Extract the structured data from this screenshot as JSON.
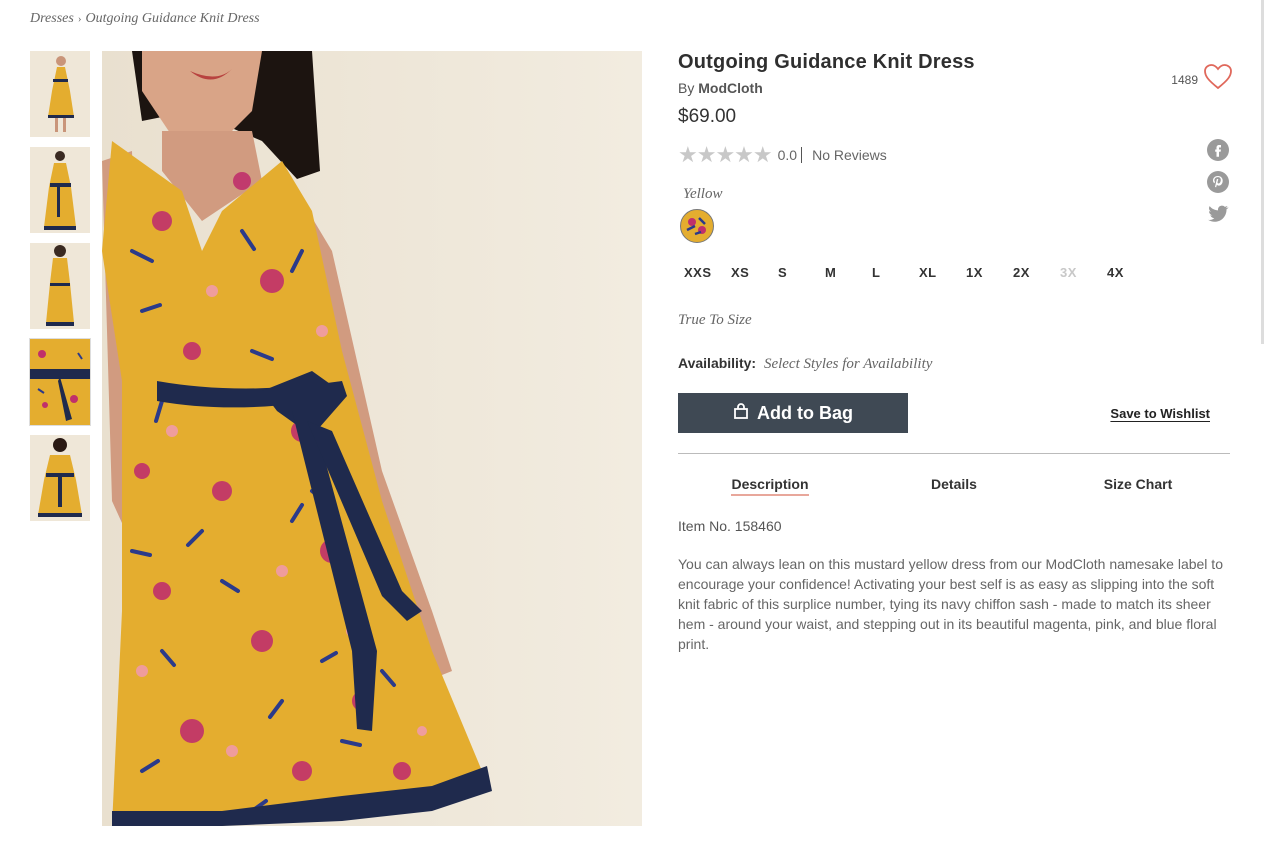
{
  "breadcrumb": {
    "parent": "Dresses",
    "separator": "›",
    "current": "Outgoing Guidance Knit Dress"
  },
  "product": {
    "title": "Outgoing Guidance Knit Dress",
    "by_prefix": "By",
    "brand": "ModCloth",
    "price": "$69.00",
    "rating_stars": "★★★★★",
    "rating_value": "0.0",
    "reviews_label": "No Reviews",
    "favorites_count": "1489",
    "color_name": "Yellow",
    "sizes": [
      {
        "label": "XXS",
        "available": true
      },
      {
        "label": "XS",
        "available": true
      },
      {
        "label": "S",
        "available": true
      },
      {
        "label": "M",
        "available": true
      },
      {
        "label": "L",
        "available": true
      },
      {
        "label": "XL",
        "available": true
      },
      {
        "label": "1X",
        "available": true
      },
      {
        "label": "2X",
        "available": true
      },
      {
        "label": "3X",
        "available": false
      },
      {
        "label": "4X",
        "available": true
      }
    ],
    "fit": "True To Size",
    "availability_label": "Availability:",
    "availability_value": "Select Styles for Availability",
    "add_to_bag": "Add to Bag",
    "save_to_wishlist": "Save to Wishlist",
    "tabs": [
      "Description",
      "Details",
      "Size Chart"
    ],
    "item_no": "Item No. 158460",
    "description": "You can always lean on this mustard yellow dress from our ModCloth namesake label to encourage your confidence! Activating your best self is as easy as slipping into the soft knit fabric of this surplice number, tying its navy chiffon sash - made to match its sheer hem - around your waist, and stepping out in its beautiful magenta, pink, and blue floral print."
  },
  "social": [
    "facebook-icon",
    "pinterest-icon",
    "twitter-icon"
  ],
  "thumbnails": [
    "thumb-1",
    "thumb-2",
    "thumb-3",
    "thumb-4",
    "thumb-5"
  ],
  "colors": {
    "button": "#3f4954",
    "dress": "#e4ad2f",
    "sash": "#1f2a4d",
    "heart": "#e0685b",
    "tab_underline": "#e8a79b"
  }
}
